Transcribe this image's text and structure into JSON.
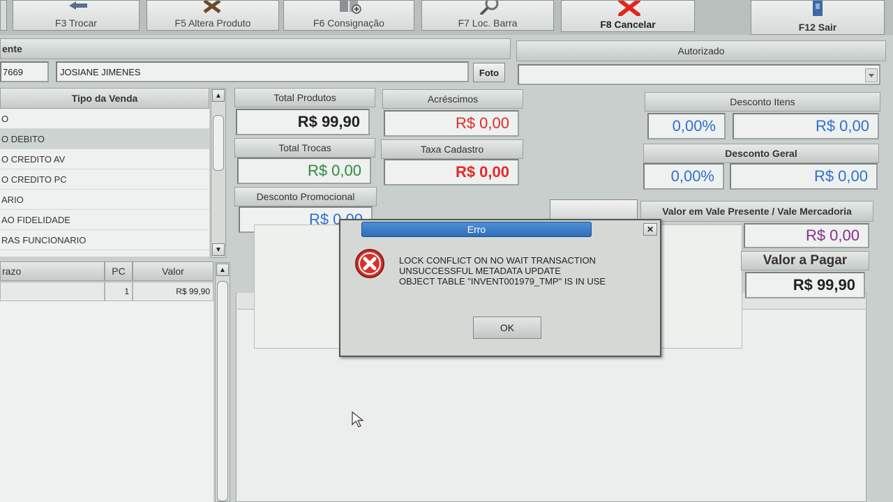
{
  "toolbar": {
    "buttons": [
      {
        "label": "F3 Trocar",
        "icon": "arrow-left-icon"
      },
      {
        "label": "F5 Altera Produto",
        "icon": "tools-icon"
      },
      {
        "label": "F6 Consignação",
        "icon": "boxes-icon"
      },
      {
        "label": "F7 Loc. Barra",
        "icon": "magnifier-icon"
      },
      {
        "label": "F8 Cancelar",
        "icon": "red-x-icon"
      },
      {
        "label": "F12 Sair",
        "icon": "exit-door-icon"
      }
    ]
  },
  "client": {
    "header": "ente",
    "code": "7669",
    "name": "JOSIANE JIMENES",
    "photo_label": "Foto"
  },
  "authorized": {
    "header": "Autorizado",
    "value": ""
  },
  "sale_type": {
    "header": "Tipo da Venda",
    "items": [
      "O",
      "O DEBITO",
      "O CREDITO AV",
      "O CREDITO PC",
      "ARIO",
      "AO FIDELIDADE",
      "RAS FUNCIONARIO"
    ],
    "selected_index": 1
  },
  "installments": {
    "headers": [
      "razo",
      "PC",
      "Valor"
    ],
    "rows": [
      {
        "prazo": "",
        "pc": "1",
        "valor": "R$ 99,90"
      }
    ]
  },
  "totals": {
    "total_produtos": {
      "label": "Total Produtos",
      "value": "R$ 99,90"
    },
    "acrescimos": {
      "label": "Acréscimos",
      "value": "R$ 0,00"
    },
    "total_trocas": {
      "label": "Total Trocas",
      "value": "R$ 0,00"
    },
    "taxa_cadastro": {
      "label": "Taxa Cadastro",
      "value": "R$ 0,00"
    },
    "desconto_promocional": {
      "label": "Desconto Promocional",
      "value": "R$ 0,00"
    },
    "desconto_itens": {
      "label": "Desconto Itens",
      "percent": "0,00%",
      "value": "R$ 0,00"
    },
    "desconto_geral": {
      "label": "Desconto Geral",
      "percent": "0,00%",
      "value": "R$ 0,00"
    },
    "vale_presente": {
      "label": "Valor em Vale Presente / Vale Mercadoria",
      "value": "R$ 0,00"
    },
    "valor_pagar": {
      "label": "Valor a Pagar",
      "value": "R$ 99,90"
    }
  },
  "dialog": {
    "title": "Erro",
    "lines": [
      "LOCK CONFLICT ON NO WAIT TRANSACTION",
      "UNSUCCESSFUL METADATA UPDATE",
      "OBJECT TABLE \"INVENT001979_TMP\" IS IN USE"
    ],
    "ok_label": "OK",
    "icon": "error-icon",
    "close_icon": "close-icon"
  },
  "colors": {
    "accent_blue": "#2f6fd3",
    "error_red": "#e32a2a",
    "positive_green": "#2d8a3c",
    "voucher_purple": "#8b2d8f",
    "dialog_title": "#2e6fb8"
  }
}
